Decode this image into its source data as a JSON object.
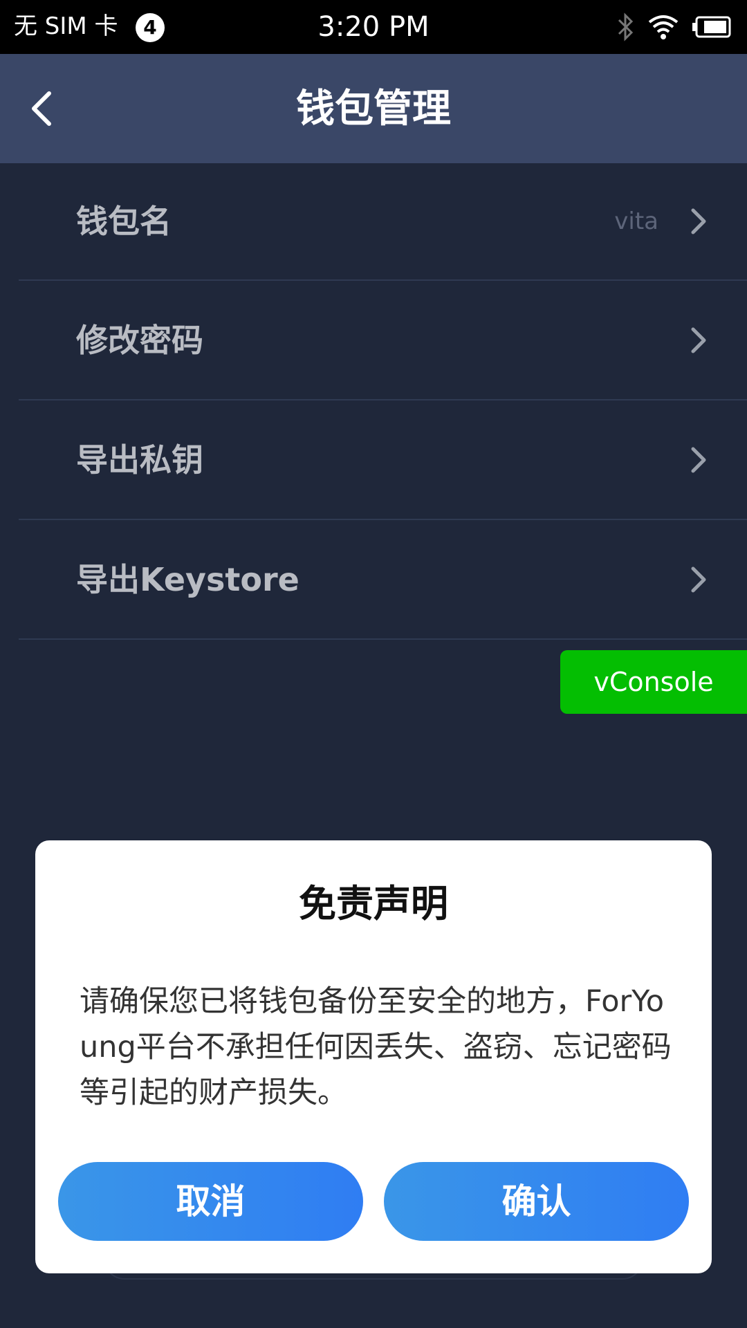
{
  "status_bar": {
    "carrier": "无 SIM 卡",
    "notification_count": "4",
    "time": "3:20 PM"
  },
  "header": {
    "title": "钱包管理"
  },
  "menu": [
    {
      "label": "钱包名",
      "value": "vita"
    },
    {
      "label": "修改密码"
    },
    {
      "label": "导出私钥"
    },
    {
      "label": "导出Keystore"
    }
  ],
  "vconsole_label": "vConsole",
  "dialog": {
    "title": "免责声明",
    "body": "请确保您已将钱包备份至安全的地方，ForYoung平台不承担任何因丢失、盗窃、忘记密码等引起的财产损失。",
    "cancel_label": "取消",
    "confirm_label": "确认"
  },
  "colors": {
    "background": "#1f273a",
    "header": "#3a4767",
    "vconsole": "#04be02",
    "button_gradient_start": "#3a96e8",
    "button_gradient_end": "#2f7df3"
  }
}
